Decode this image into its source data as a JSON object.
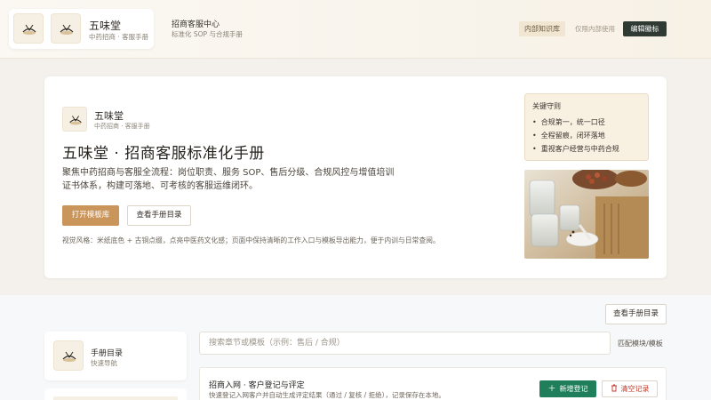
{
  "header": {
    "brand_name": "五味堂",
    "brand_sub": "中药招商 · 客服手册",
    "center_title": "招商客服中心",
    "center_sub": "标准化 SOP 与合规手册",
    "kb_badge": "内部知识库",
    "internal_text": "仅限内部使用",
    "edit_label": "编辑徽标"
  },
  "hero": {
    "brand_name": "五味堂",
    "brand_sub": "中药招商 · 客服手册",
    "title": "五味堂 · 招商客服标准化手册",
    "description": "聚焦中药招商与客服全流程：岗位职责、服务 SOP、售后分级、合规风控与增值培训证书体系，构建可落地、可考核的客服运维闭环。",
    "open_template_label": "打开模板库",
    "view_toc_label": "查看手册目录",
    "style_note": "视觉风格：米纸底色 + 古铜点缀，点亮中医药文化感；页面中保持清晰的工作入口与模板导出能力，便于内训与日常查阅。",
    "rules": {
      "title": "关键守则",
      "items": [
        "合规第一，统一口径",
        "全程留痕，闭环落地",
        "重视客户经营与中药合规"
      ]
    }
  },
  "lower": {
    "view_toc_label": "查看手册目录",
    "side_title": "手册目录",
    "side_sub": "快速导航",
    "search_placeholder": "搜索章节或模板（示例：售后 / 合规）",
    "match_label": "匹配模块/模板",
    "entry": {
      "title": "招商入网 · 客户登记与评定",
      "description": "快速登记入网客户并自动生成评定结果（通过 / 复核 / 拒绝），记录保存在本地。",
      "add_label": "新增登记",
      "clear_label": "清空记录",
      "add_icon": "plus-icon",
      "clear_icon": "trash-icon"
    }
  },
  "colors": {
    "accent": "#c9955a",
    "dark": "#2f3a33",
    "green": "#1f7f5a",
    "danger": "#c0392b"
  }
}
